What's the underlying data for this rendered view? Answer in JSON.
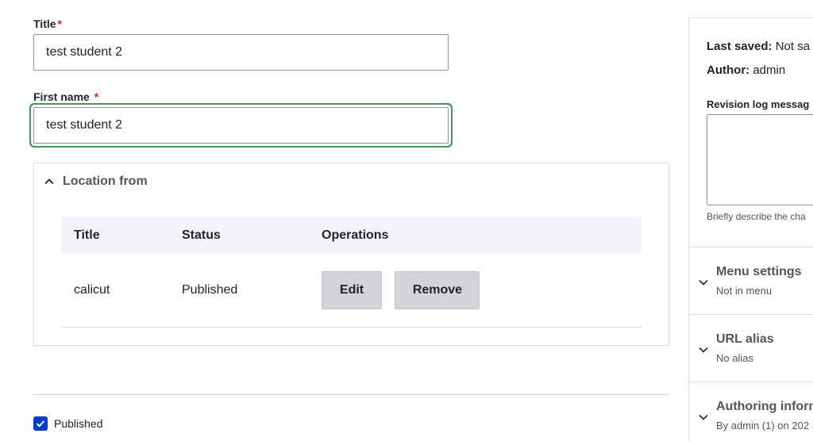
{
  "form": {
    "title_label": "Title",
    "required_mark": "*",
    "title_value": "test student 2",
    "first_name_label": "First name",
    "first_name_value": "test student 2"
  },
  "location": {
    "summary": "Location from",
    "columns": [
      "Title",
      "Status",
      "Operations"
    ],
    "rows": [
      {
        "title": "calicut",
        "status": "Published",
        "edit": "Edit",
        "remove": "Remove"
      }
    ]
  },
  "published": {
    "label": "Published",
    "checked": true
  },
  "sidebar": {
    "last_saved_label": "Last saved:",
    "last_saved_value": "Not sa",
    "author_label": "Author:",
    "author_value": "admin",
    "revision_label": "Revision log messag",
    "revision_desc": "Briefly describe the cha",
    "sections": [
      {
        "title": "Menu settings",
        "sub": "Not in menu"
      },
      {
        "title": "URL alias",
        "sub": "No alias"
      },
      {
        "title": "Authoring inform",
        "sub": "By admin (1) on 202"
      }
    ]
  },
  "colors": {
    "focus": "#3f9c5e",
    "checkbox": "#003ecc",
    "required": "#d72222"
  }
}
